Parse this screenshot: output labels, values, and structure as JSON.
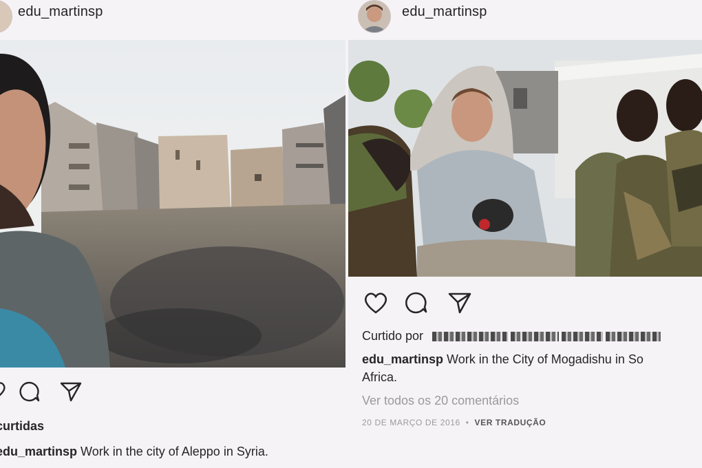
{
  "left_post": {
    "username": "edu_martinsp",
    "likes_label": "curtidas",
    "caption_user": "edu_martinsp",
    "caption_text": "Work in the city of Aleppo in Syria."
  },
  "right_post": {
    "username": "edu_martinsp",
    "liked_by_label": "Curtido por",
    "caption_user": "edu_martinsp",
    "caption_text_line1": "Work in the City of Mogadishu in So",
    "caption_text_line2": "Africa.",
    "view_comments": "Ver todos os 20 comentários",
    "date": "20 DE MARÇO DE 2016",
    "separator": "•",
    "translate": "VER TRADUÇÃO"
  },
  "icons": [
    "heart-icon",
    "comment-icon",
    "share-icon"
  ]
}
